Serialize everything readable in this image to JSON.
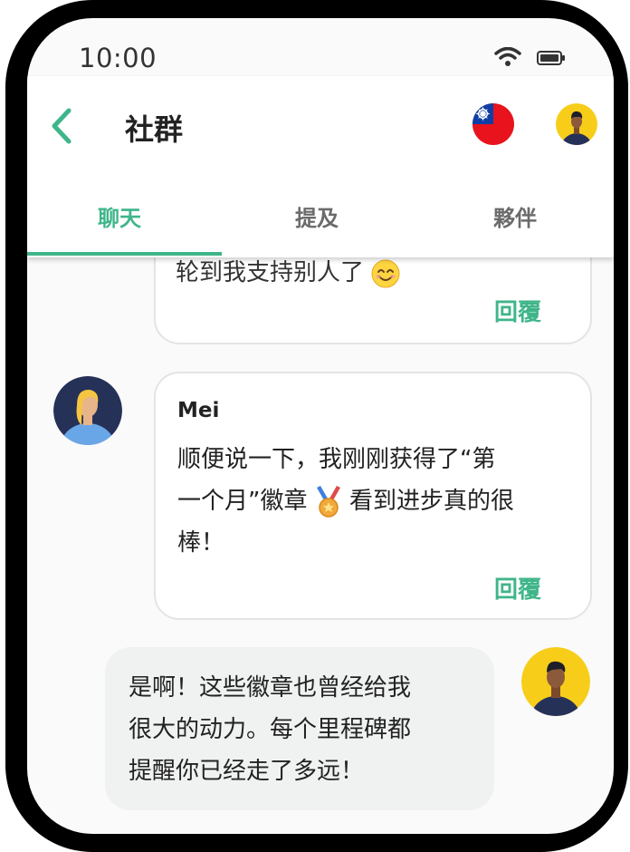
{
  "status": {
    "time": "10:00"
  },
  "header": {
    "title": "社群"
  },
  "tabs": [
    {
      "label": "聊天",
      "active": true
    },
    {
      "label": "提及",
      "active": false
    },
    {
      "label": "夥伴",
      "active": false
    }
  ],
  "messages": {
    "previous": {
      "text": "轮到我支持别人了",
      "reply": "回覆"
    },
    "mei": {
      "author": "Mei",
      "line1": "顺便说一下，我刚刚获得了“第",
      "line2a": "一个月”徽章",
      "line2b": "看到进步真的很",
      "line3": "棒！",
      "reply": "回覆"
    },
    "mine": {
      "line1": "是啊！这些徽章也曾经给我",
      "line2": "很大的动力。每个里程碑都",
      "line3": "提醒你已经走了多远！"
    }
  },
  "icons": {
    "back": "chevron-left-icon",
    "flag": "taiwan-flag-icon",
    "wifi": "wifi-icon",
    "battery": "battery-icon",
    "smile": "smiling-face-emoji",
    "medal": "medal-emoji"
  },
  "colors": {
    "accent": "#3fb58a",
    "bubble_mine": "#f0f2f1"
  }
}
